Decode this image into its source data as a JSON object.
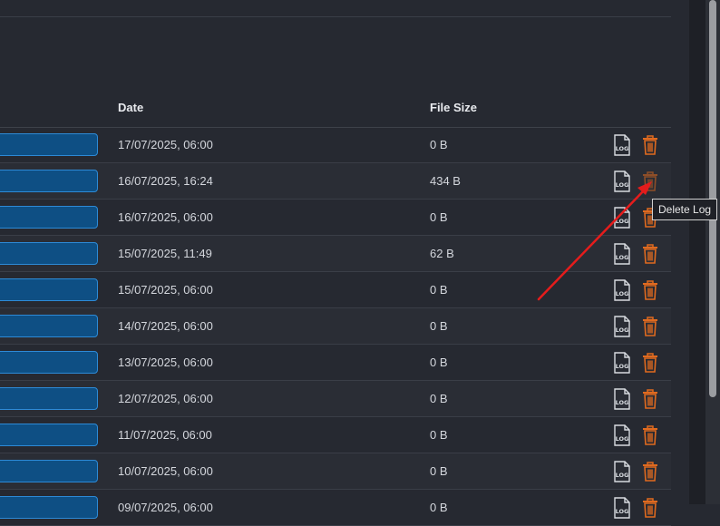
{
  "table": {
    "headers": {
      "date": "Date",
      "file_size": "File Size"
    },
    "rows": [
      {
        "date": "17/07/2025, 06:00",
        "size": "0 B"
      },
      {
        "date": "16/07/2025, 16:24",
        "size": "434 B"
      },
      {
        "date": "16/07/2025, 06:00",
        "size": "0 B"
      },
      {
        "date": "15/07/2025, 11:49",
        "size": "62 B"
      },
      {
        "date": "15/07/2025, 06:00",
        "size": "0 B"
      },
      {
        "date": "14/07/2025, 06:00",
        "size": "0 B"
      },
      {
        "date": "13/07/2025, 06:00",
        "size": "0 B"
      },
      {
        "date": "12/07/2025, 06:00",
        "size": "0 B"
      },
      {
        "date": "11/07/2025, 06:00",
        "size": "0 B"
      },
      {
        "date": "10/07/2025, 06:00",
        "size": "0 B"
      },
      {
        "date": "09/07/2025, 06:00",
        "size": "0 B"
      }
    ],
    "actions": {
      "view_icon": "log-file-icon",
      "delete_icon": "trash-icon",
      "delete_color": "#e06a1f"
    }
  },
  "tooltip": {
    "text": "Delete Log"
  },
  "annotation": {
    "arrow_color": "#e51c1c"
  },
  "colors": {
    "name_button": "#0e4f84",
    "name_button_border": "#2d8ad6",
    "background": "#262931"
  }
}
